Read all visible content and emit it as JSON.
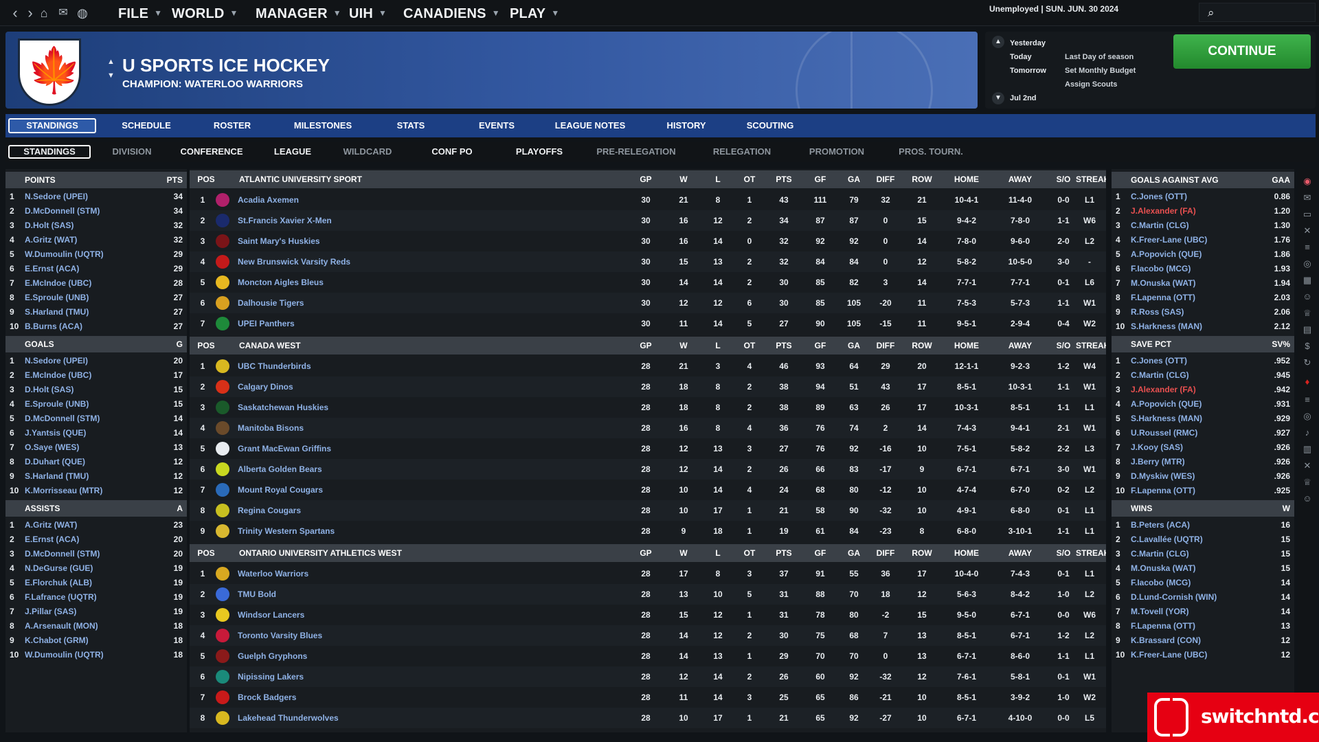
{
  "topbar": {
    "menus": [
      "FILE",
      "WORLD",
      "MANAGER",
      "UIH",
      "CANADIENS",
      "PLAY"
    ],
    "status": "Unemployed | SUN. JUN. 30 2024"
  },
  "header": {
    "title": "U SPORTS ICE HOCKEY",
    "subtitle": "CHAMPION: WATERLOO WARRIORS"
  },
  "calendar": {
    "days": [
      "Yesterday",
      "Today",
      "Tomorrow",
      "Jul 2nd"
    ],
    "events": [
      "Last Day of season",
      "Set Monthly Budget",
      "Assign Scouts"
    ],
    "continue_label": "CONTINUE"
  },
  "tabs_main": [
    "STANDINGS",
    "SCHEDULE",
    "ROSTER",
    "MILESTONES",
    "STATS",
    "EVENTS",
    "LEAGUE NOTES",
    "HISTORY",
    "SCOUTING"
  ],
  "tabs_sub": [
    "STANDINGS",
    "DIVISION",
    "CONFERENCE",
    "LEAGUE",
    "WILDCARD",
    "CONF PO",
    "PLAYOFFS",
    "PRE-RELEGATION",
    "RELEGATION",
    "PROMOTION",
    "PROS. TOURN."
  ],
  "left_panel": [
    {
      "title": "POINTS",
      "unit": "PTS",
      "rows": [
        [
          "1",
          "N.Sedore (UPEI)",
          "34"
        ],
        [
          "2",
          "D.McDonnell (STM)",
          "34"
        ],
        [
          "3",
          "D.Holt (SAS)",
          "32"
        ],
        [
          "4",
          "A.Gritz (WAT)",
          "32"
        ],
        [
          "5",
          "W.Dumoulin (UQTR)",
          "29"
        ],
        [
          "6",
          "E.Ernst (ACA)",
          "29"
        ],
        [
          "7",
          "E.McIndoe (UBC)",
          "28"
        ],
        [
          "8",
          "E.Sproule (UNB)",
          "27"
        ],
        [
          "9",
          "S.Harland (TMU)",
          "27"
        ],
        [
          "10",
          "B.Burns (ACA)",
          "27"
        ]
      ]
    },
    {
      "title": "GOALS",
      "unit": "G",
      "rows": [
        [
          "1",
          "N.Sedore (UPEI)",
          "20"
        ],
        [
          "2",
          "E.McIndoe (UBC)",
          "17"
        ],
        [
          "3",
          "D.Holt (SAS)",
          "15"
        ],
        [
          "4",
          "E.Sproule (UNB)",
          "15"
        ],
        [
          "5",
          "D.McDonnell (STM)",
          "14"
        ],
        [
          "6",
          "J.Yantsis (QUE)",
          "14"
        ],
        [
          "7",
          "O.Saye (WES)",
          "13"
        ],
        [
          "8",
          "D.Duhart (QUE)",
          "12"
        ],
        [
          "9",
          "S.Harland (TMU)",
          "12"
        ],
        [
          "10",
          "K.Morrisseau (MTR)",
          "12"
        ]
      ]
    },
    {
      "title": "ASSISTS",
      "unit": "A",
      "rows": [
        [
          "1",
          "A.Gritz (WAT)",
          "23"
        ],
        [
          "2",
          "E.Ernst (ACA)",
          "20"
        ],
        [
          "3",
          "D.McDonnell (STM)",
          "20"
        ],
        [
          "4",
          "N.DeGurse (GUE)",
          "19"
        ],
        [
          "5",
          "E.Florchuk (ALB)",
          "19"
        ],
        [
          "6",
          "F.Lafrance (UQTR)",
          "19"
        ],
        [
          "7",
          "J.Pillar (SAS)",
          "19"
        ],
        [
          "8",
          "A.Arsenault (MON)",
          "18"
        ],
        [
          "9",
          "K.Chabot (GRM)",
          "18"
        ],
        [
          "10",
          "W.Dumoulin (UQTR)",
          "18"
        ]
      ]
    }
  ],
  "right_panel": [
    {
      "title": "GOALS AGAINST AVG",
      "unit": "GAA",
      "rows": [
        [
          "1",
          "C.Jones (OTT)",
          "0.86"
        ],
        [
          "2",
          "J.Alexander (FA)",
          "1.20"
        ],
        [
          "3",
          "C.Martin (CLG)",
          "1.30"
        ],
        [
          "4",
          "K.Freer-Lane (UBC)",
          "1.76"
        ],
        [
          "5",
          "A.Popovich (QUE)",
          "1.86"
        ],
        [
          "6",
          "F.Iacobo (MCG)",
          "1.93"
        ],
        [
          "7",
          "M.Onuska (WAT)",
          "1.94"
        ],
        [
          "8",
          "F.Lapenna (OTT)",
          "2.03"
        ],
        [
          "9",
          "R.Ross (SAS)",
          "2.06"
        ],
        [
          "10",
          "S.Harkness (MAN)",
          "2.12"
        ]
      ]
    },
    {
      "title": "SAVE PCT",
      "unit": "SV%",
      "rows": [
        [
          "1",
          "C.Jones (OTT)",
          ".952"
        ],
        [
          "2",
          "C.Martin (CLG)",
          ".945"
        ],
        [
          "3",
          "J.Alexander (FA)",
          ".942"
        ],
        [
          "4",
          "A.Popovich (QUE)",
          ".931"
        ],
        [
          "5",
          "S.Harkness (MAN)",
          ".929"
        ],
        [
          "6",
          "U.Roussel (RMC)",
          ".927"
        ],
        [
          "7",
          "J.Kooy (SAS)",
          ".926"
        ],
        [
          "8",
          "J.Berry (MTR)",
          ".926"
        ],
        [
          "9",
          "D.Myskiw (WES)",
          ".926"
        ],
        [
          "10",
          "F.Lapenna (OTT)",
          ".925"
        ]
      ]
    },
    {
      "title": "WINS",
      "unit": "W",
      "rows": [
        [
          "1",
          "B.Peters (ACA)",
          "16"
        ],
        [
          "2",
          "C.Lavallée (UQTR)",
          "15"
        ],
        [
          "3",
          "C.Martin (CLG)",
          "15"
        ],
        [
          "4",
          "M.Onuska (WAT)",
          "15"
        ],
        [
          "5",
          "F.Iacobo (MCG)",
          "14"
        ],
        [
          "6",
          "D.Lund-Cornish (WIN)",
          "14"
        ],
        [
          "7",
          "M.Tovell (YOR)",
          "14"
        ],
        [
          "8",
          "F.Lapenna (OTT)",
          "13"
        ],
        [
          "9",
          "K.Brassard (CON)",
          "12"
        ],
        [
          "10",
          "K.Freer-Lane (UBC)",
          "12"
        ]
      ]
    }
  ],
  "standings_columns": [
    "POS",
    "GP",
    "W",
    "L",
    "OT",
    "PTS",
    "GF",
    "GA",
    "DIFF",
    "ROW",
    "HOME",
    "AWAY",
    "S/O",
    "STREAK"
  ],
  "conferences": [
    {
      "name": "ATLANTIC UNIVERSITY SPORT",
      "teams": [
        {
          "pos": "1",
          "name": "Acadia Axemen",
          "color": "#b0206a",
          "gp": "30",
          "w": "21",
          "l": "8",
          "ot": "1",
          "pts": "43",
          "gf": "111",
          "ga": "79",
          "diff": "32",
          "row": "21",
          "home": "10-4-1",
          "away": "11-4-0",
          "so": "0-0",
          "streak": "L1"
        },
        {
          "pos": "2",
          "name": "St.Francis Xavier X-Men",
          "color": "#1a2a6c",
          "gp": "30",
          "w": "16",
          "l": "12",
          "ot": "2",
          "pts": "34",
          "gf": "87",
          "ga": "87",
          "diff": "0",
          "row": "15",
          "home": "9-4-2",
          "away": "7-8-0",
          "so": "1-1",
          "streak": "W6"
        },
        {
          "pos": "3",
          "name": "Saint Mary's Huskies",
          "color": "#7a1418",
          "gp": "30",
          "w": "16",
          "l": "14",
          "ot": "0",
          "pts": "32",
          "gf": "92",
          "ga": "92",
          "diff": "0",
          "row": "14",
          "home": "7-8-0",
          "away": "9-6-0",
          "so": "2-0",
          "streak": "L2"
        },
        {
          "pos": "4",
          "name": "New Brunswick Varsity Reds",
          "color": "#c41a1a",
          "gp": "30",
          "w": "15",
          "l": "13",
          "ot": "2",
          "pts": "32",
          "gf": "84",
          "ga": "84",
          "diff": "0",
          "row": "12",
          "home": "5-8-2",
          "away": "10-5-0",
          "so": "3-0",
          "streak": "-"
        },
        {
          "pos": "5",
          "name": "Moncton Aigles Bleus",
          "color": "#e8b820",
          "gp": "30",
          "w": "14",
          "l": "14",
          "ot": "2",
          "pts": "30",
          "gf": "85",
          "ga": "82",
          "diff": "3",
          "row": "14",
          "home": "7-7-1",
          "away": "7-7-1",
          "so": "0-1",
          "streak": "L6"
        },
        {
          "pos": "6",
          "name": "Dalhousie Tigers",
          "color": "#d8a020",
          "gp": "30",
          "w": "12",
          "l": "12",
          "ot": "6",
          "pts": "30",
          "gf": "85",
          "ga": "105",
          "diff": "-20",
          "row": "11",
          "home": "7-5-3",
          "away": "5-7-3",
          "so": "1-1",
          "streak": "W1"
        },
        {
          "pos": "7",
          "name": "UPEI Panthers",
          "color": "#1e8a3a",
          "gp": "30",
          "w": "11",
          "l": "14",
          "ot": "5",
          "pts": "27",
          "gf": "90",
          "ga": "105",
          "diff": "-15",
          "row": "11",
          "home": "9-5-1",
          "away": "2-9-4",
          "so": "0-4",
          "streak": "W2"
        }
      ]
    },
    {
      "name": "CANADA WEST",
      "teams": [
        {
          "pos": "1",
          "name": "UBC Thunderbirds",
          "color": "#d8b820",
          "gp": "28",
          "w": "21",
          "l": "3",
          "ot": "4",
          "pts": "46",
          "gf": "93",
          "ga": "64",
          "diff": "29",
          "row": "20",
          "home": "12-1-1",
          "away": "9-2-3",
          "so": "1-2",
          "streak": "W4"
        },
        {
          "pos": "2",
          "name": "Calgary Dinos",
          "color": "#d83018",
          "gp": "28",
          "w": "18",
          "l": "8",
          "ot": "2",
          "pts": "38",
          "gf": "94",
          "ga": "51",
          "diff": "43",
          "row": "17",
          "home": "8-5-1",
          "away": "10-3-1",
          "so": "1-1",
          "streak": "W1"
        },
        {
          "pos": "3",
          "name": "Saskatchewan Huskies",
          "color": "#1a5a2a",
          "gp": "28",
          "w": "18",
          "l": "8",
          "ot": "2",
          "pts": "38",
          "gf": "89",
          "ga": "63",
          "diff": "26",
          "row": "17",
          "home": "10-3-1",
          "away": "8-5-1",
          "so": "1-1",
          "streak": "L1"
        },
        {
          "pos": "4",
          "name": "Manitoba Bisons",
          "color": "#6a4a2a",
          "gp": "28",
          "w": "16",
          "l": "8",
          "ot": "4",
          "pts": "36",
          "gf": "76",
          "ga": "74",
          "diff": "2",
          "row": "14",
          "home": "7-4-3",
          "away": "9-4-1",
          "so": "2-1",
          "streak": "W1"
        },
        {
          "pos": "5",
          "name": "Grant MacEwan Griffins",
          "color": "#e8ecf0",
          "gp": "28",
          "w": "12",
          "l": "13",
          "ot": "3",
          "pts": "27",
          "gf": "76",
          "ga": "92",
          "diff": "-16",
          "row": "10",
          "home": "7-5-1",
          "away": "5-8-2",
          "so": "2-2",
          "streak": "L3"
        },
        {
          "pos": "6",
          "name": "Alberta Golden Bears",
          "color": "#c8d820",
          "gp": "28",
          "w": "12",
          "l": "14",
          "ot": "2",
          "pts": "26",
          "gf": "66",
          "ga": "83",
          "diff": "-17",
          "row": "9",
          "home": "6-7-1",
          "away": "6-7-1",
          "so": "3-0",
          "streak": "W1"
        },
        {
          "pos": "7",
          "name": "Mount Royal Cougars",
          "color": "#2a6ab8",
          "gp": "28",
          "w": "10",
          "l": "14",
          "ot": "4",
          "pts": "24",
          "gf": "68",
          "ga": "80",
          "diff": "-12",
          "row": "10",
          "home": "4-7-4",
          "away": "6-7-0",
          "so": "0-2",
          "streak": "L2"
        },
        {
          "pos": "8",
          "name": "Regina Cougars",
          "color": "#c8c020",
          "gp": "28",
          "w": "10",
          "l": "17",
          "ot": "1",
          "pts": "21",
          "gf": "58",
          "ga": "90",
          "diff": "-32",
          "row": "10",
          "home": "4-9-1",
          "away": "6-8-0",
          "so": "0-1",
          "streak": "L1"
        },
        {
          "pos": "9",
          "name": "Trinity Western Spartans",
          "color": "#d8b830",
          "gp": "28",
          "w": "9",
          "l": "18",
          "ot": "1",
          "pts": "19",
          "gf": "61",
          "ga": "84",
          "diff": "-23",
          "row": "8",
          "home": "6-8-0",
          "away": "3-10-1",
          "so": "1-1",
          "streak": "L1"
        }
      ]
    },
    {
      "name": "ONTARIO UNIVERSITY ATHLETICS WEST",
      "teams": [
        {
          "pos": "1",
          "name": "Waterloo Warriors",
          "color": "#d8a820",
          "gp": "28",
          "w": "17",
          "l": "8",
          "ot": "3",
          "pts": "37",
          "gf": "91",
          "ga": "55",
          "diff": "36",
          "row": "17",
          "home": "10-4-0",
          "away": "7-4-3",
          "so": "0-1",
          "streak": "L1"
        },
        {
          "pos": "2",
          "name": "TMU Bold",
          "color": "#3a6ad8",
          "gp": "28",
          "w": "13",
          "l": "10",
          "ot": "5",
          "pts": "31",
          "gf": "88",
          "ga": "70",
          "diff": "18",
          "row": "12",
          "home": "5-6-3",
          "away": "8-4-2",
          "so": "1-0",
          "streak": "L2"
        },
        {
          "pos": "3",
          "name": "Windsor Lancers",
          "color": "#e8c820",
          "gp": "28",
          "w": "15",
          "l": "12",
          "ot": "1",
          "pts": "31",
          "gf": "78",
          "ga": "80",
          "diff": "-2",
          "row": "15",
          "home": "9-5-0",
          "away": "6-7-1",
          "so": "0-0",
          "streak": "W6"
        },
        {
          "pos": "4",
          "name": "Toronto Varsity Blues",
          "color": "#c81a3a",
          "gp": "28",
          "w": "14",
          "l": "12",
          "ot": "2",
          "pts": "30",
          "gf": "75",
          "ga": "68",
          "diff": "7",
          "row": "13",
          "home": "8-5-1",
          "away": "6-7-1",
          "so": "1-2",
          "streak": "L2"
        },
        {
          "pos": "5",
          "name": "Guelph Gryphons",
          "color": "#8a1a1a",
          "gp": "28",
          "w": "14",
          "l": "13",
          "ot": "1",
          "pts": "29",
          "gf": "70",
          "ga": "70",
          "diff": "0",
          "row": "13",
          "home": "6-7-1",
          "away": "8-6-0",
          "so": "1-1",
          "streak": "L1"
        },
        {
          "pos": "6",
          "name": "Nipissing Lakers",
          "color": "#1a8a7a",
          "gp": "28",
          "w": "12",
          "l": "14",
          "ot": "2",
          "pts": "26",
          "gf": "60",
          "ga": "92",
          "diff": "-32",
          "row": "12",
          "home": "7-6-1",
          "away": "5-8-1",
          "so": "0-1",
          "streak": "W1"
        },
        {
          "pos": "7",
          "name": "Brock Badgers",
          "color": "#c81a1a",
          "gp": "28",
          "w": "11",
          "l": "14",
          "ot": "3",
          "pts": "25",
          "gf": "65",
          "ga": "86",
          "diff": "-21",
          "row": "10",
          "home": "8-5-1",
          "away": "3-9-2",
          "so": "1-0",
          "streak": "W2"
        },
        {
          "pos": "8",
          "name": "Lakehead Thunderwolves",
          "color": "#d8b820",
          "gp": "28",
          "w": "10",
          "l": "17",
          "ot": "1",
          "pts": "21",
          "gf": "65",
          "ga": "92",
          "diff": "-27",
          "row": "10",
          "home": "6-7-1",
          "away": "4-10-0",
          "so": "0-0",
          "streak": "L5"
        }
      ]
    }
  ],
  "red_names": [
    "J.Alexander (FA)"
  ],
  "watermark": "switchntd.com"
}
